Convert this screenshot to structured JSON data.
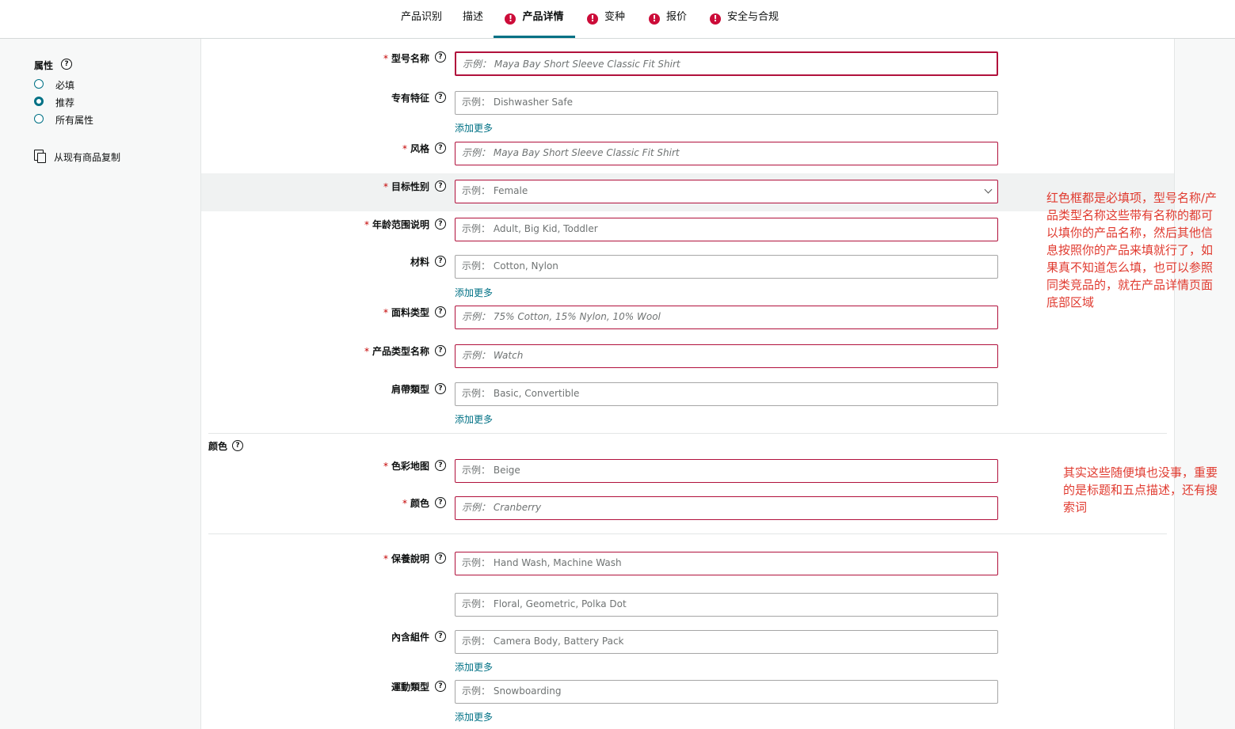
{
  "tabs": [
    {
      "label": "产品识别",
      "error": false,
      "active": false
    },
    {
      "label": "描述",
      "error": false,
      "active": false
    },
    {
      "label": "产品详情",
      "error": true,
      "active": true
    },
    {
      "label": "变种",
      "error": true,
      "active": false
    },
    {
      "label": "报价",
      "error": true,
      "active": false
    },
    {
      "label": "安全与合规",
      "error": true,
      "active": false
    }
  ],
  "sidebar": {
    "title": "属性",
    "filters": [
      {
        "label": "必填",
        "selected": false
      },
      {
        "label": "推荐",
        "selected": true
      },
      {
        "label": "所有属性",
        "selected": false
      }
    ],
    "copy_label": "从现有商品复制"
  },
  "form": {
    "example_prefix": "示例：",
    "add_more": "添加更多",
    "color_section": "颜色",
    "fields": {
      "model_name": {
        "label": "型号名称",
        "required": true,
        "placeholder": "Maya Bay Short Sleeve Classic Fit Shirt"
      },
      "special_feature": {
        "label": "专有特征",
        "required": false,
        "placeholder": "Dishwasher Safe"
      },
      "style": {
        "label": "风格",
        "required": true,
        "placeholder": "Maya Bay Short Sleeve Classic Fit Shirt"
      },
      "target_gender": {
        "label": "目标性别",
        "required": true,
        "placeholder": "Female"
      },
      "age_range": {
        "label": "年龄范围说明",
        "required": true,
        "placeholder": "Adult, Big Kid, Toddler"
      },
      "material": {
        "label": "材料",
        "required": false,
        "placeholder": "Cotton, Nylon"
      },
      "fabric_type": {
        "label": "面料类型",
        "required": true,
        "placeholder": "75% Cotton, 15% Nylon, 10% Wool"
      },
      "product_type_name": {
        "label": "产品类型名称",
        "required": true,
        "placeholder": "Watch"
      },
      "strap_type": {
        "label": "肩帶類型",
        "required": false,
        "placeholder": "Basic, Convertible"
      },
      "color_map": {
        "label": "色彩地图",
        "required": true,
        "placeholder": "Beige"
      },
      "color": {
        "label": "颜色",
        "required": true,
        "placeholder": "Cranberry"
      },
      "care_instructions": {
        "label": "保養說明",
        "required": true,
        "placeholder": "Hand Wash, Machine Wash"
      },
      "pattern": {
        "label": "",
        "required": false,
        "placeholder": "Floral, Geometric, Polka Dot"
      },
      "included_components": {
        "label": "內含組件",
        "required": false,
        "placeholder": "Camera Body, Battery Pack"
      },
      "sport_type": {
        "label": "運動類型",
        "required": false,
        "placeholder": "Snowboarding"
      }
    }
  },
  "annotations": {
    "note1_lines": [
      "红色框都是必填项，型号名称/产",
      "品类型名称这些带有名称的都可",
      "以填你的产品名称，然后其他信",
      "息按照你的产品来填就行了，如",
      "果真不知道怎么填，也可以参照",
      "同类竞品的，就在产品详情页面",
      "底部区域"
    ],
    "note2_lines": [
      "其实这些随便填也没事，重要",
      "的是标题和五点描述，还有搜",
      "索词"
    ]
  },
  "colors": {
    "accent": "#007185",
    "required_border": "#b1113c",
    "error": "#cc0c39",
    "annotation": "#e03a2f"
  }
}
